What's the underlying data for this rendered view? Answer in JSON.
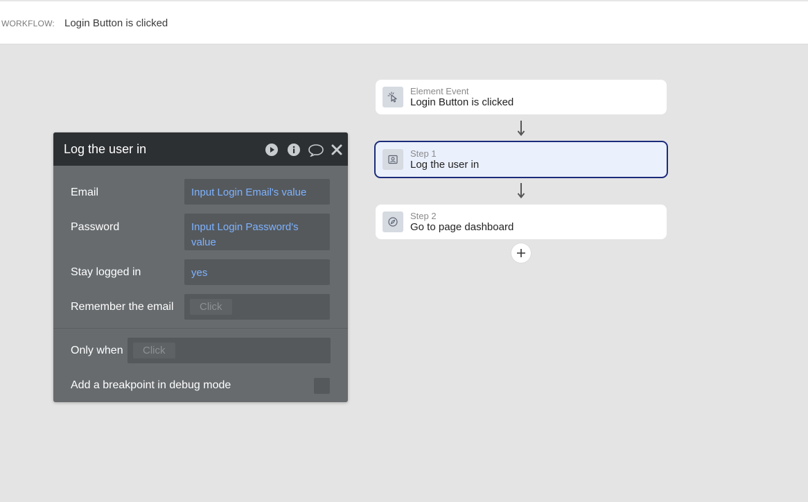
{
  "topbar": {
    "label": "WORKFLOW:",
    "title": "Login Button is clicked"
  },
  "panel": {
    "title": "Log the user in",
    "header_icons": [
      "play-icon",
      "info-icon",
      "comment-icon",
      "close-icon"
    ],
    "fields": [
      {
        "label": "Email",
        "value": "Input Login Email's value"
      },
      {
        "label": "Password",
        "value": "Input Login Password's value"
      },
      {
        "label": "Stay logged in",
        "value": "yes"
      },
      {
        "label": "Remember the email",
        "value": "Click"
      }
    ],
    "only_when": {
      "label": "Only when",
      "value": "Click"
    },
    "breakpoint": {
      "label": "Add a breakpoint in debug mode",
      "checked": false
    }
  },
  "flow": {
    "cards": [
      {
        "kicker": "Element Event",
        "title": "Login Button is clicked",
        "icon": "cursor-click-icon",
        "selected": false
      },
      {
        "kicker": "Step 1",
        "title": "Log the user in",
        "icon": "user-card-icon",
        "selected": true
      },
      {
        "kicker": "Step 2",
        "title": "Go to page dashboard",
        "icon": "compass-icon",
        "selected": false
      }
    ],
    "add_icon": "plus-icon"
  },
  "colors": {
    "canvas": "#e4e4e4",
    "panel_bg": "#676b6e",
    "panel_header": "#2d3033",
    "dynamic_text": "#7eb2ff",
    "selected_border": "#1b2a7a",
    "selected_bg": "#eaf0fc"
  }
}
